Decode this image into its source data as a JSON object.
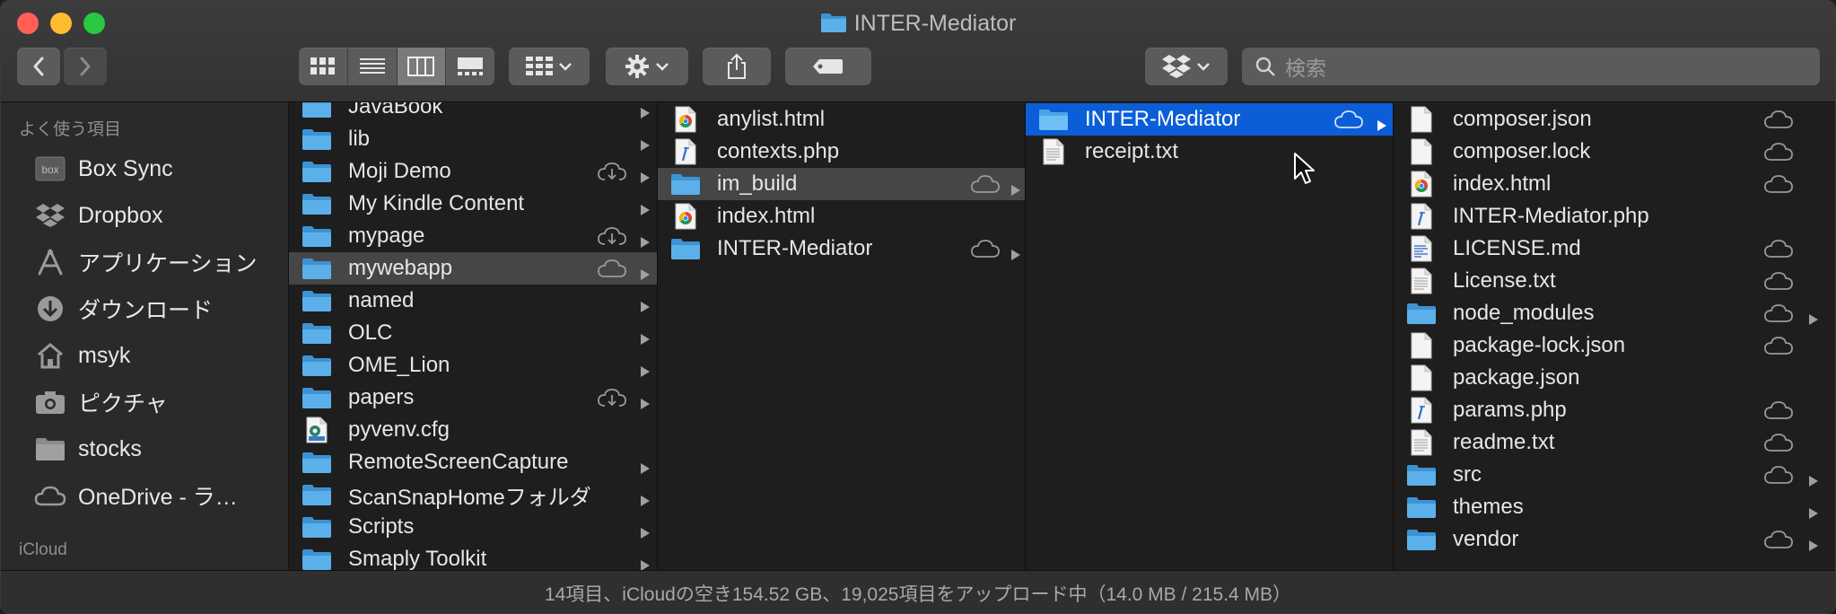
{
  "window": {
    "title": "INTER-Mediator"
  },
  "search": {
    "placeholder": "検索"
  },
  "sidebar": {
    "favorites_header": "よく使う項目",
    "icloud_header": "iCloud",
    "items": [
      {
        "label": "Box Sync",
        "icon": "box-icon"
      },
      {
        "label": "Dropbox",
        "icon": "dropbox-icon"
      },
      {
        "label": "アプリケーション",
        "icon": "applications-icon"
      },
      {
        "label": "ダウンロード",
        "icon": "downloads-icon"
      },
      {
        "label": "msyk",
        "icon": "home-icon"
      },
      {
        "label": "ピクチャ",
        "icon": "camera-icon"
      },
      {
        "label": "stocks",
        "icon": "folder-icon"
      },
      {
        "label": "OneDrive - ラ…",
        "icon": "cloud-icon"
      }
    ]
  },
  "columns": [
    {
      "items": [
        {
          "name": "JavaBook",
          "type": "folder",
          "arrow": true
        },
        {
          "name": "lib",
          "type": "folder",
          "arrow": true
        },
        {
          "name": "Moji Demo",
          "type": "folder",
          "cloud": "download",
          "arrow": true
        },
        {
          "name": "My Kindle Content",
          "type": "folder",
          "arrow": true
        },
        {
          "name": "mypage",
          "type": "folder",
          "cloud": "download",
          "arrow": true
        },
        {
          "name": "mywebapp",
          "type": "folder",
          "cloud": "cloud",
          "arrow": true,
          "selected": "gray"
        },
        {
          "name": "named",
          "type": "folder",
          "arrow": true
        },
        {
          "name": "OLC",
          "type": "folder",
          "arrow": true
        },
        {
          "name": "OME_Lion",
          "type": "folder",
          "arrow": true
        },
        {
          "name": "papers",
          "type": "folder",
          "cloud": "download",
          "arrow": true
        },
        {
          "name": "pyvenv.cfg",
          "type": "cfg"
        },
        {
          "name": "RemoteScreenCapture",
          "type": "folder",
          "arrow": true
        },
        {
          "name": "ScanSnapHomeフォルダ",
          "type": "folder",
          "arrow": true
        },
        {
          "name": "Scripts",
          "type": "folder",
          "arrow": true
        },
        {
          "name": "Smaply Toolkit",
          "type": "folder",
          "arrow": true
        }
      ]
    },
    {
      "items": [
        {
          "name": "anylist.html",
          "type": "chrome"
        },
        {
          "name": "contexts.php",
          "type": "php"
        },
        {
          "name": "im_build",
          "type": "folder",
          "cloud": "cloud",
          "arrow": true,
          "selected": "gray"
        },
        {
          "name": "index.html",
          "type": "chrome"
        },
        {
          "name": "INTER-Mediator",
          "type": "folder",
          "cloud": "cloud",
          "arrow": true
        }
      ]
    },
    {
      "items": [
        {
          "name": "INTER-Mediator",
          "type": "folder",
          "cloud": "cloud",
          "arrow": true,
          "selected": "blue"
        },
        {
          "name": "receipt.txt",
          "type": "txt"
        }
      ]
    },
    {
      "items": [
        {
          "name": "composer.json",
          "type": "doc",
          "cloud": "cloud"
        },
        {
          "name": "composer.lock",
          "type": "doc",
          "cloud": "cloud"
        },
        {
          "name": "index.html",
          "type": "chrome",
          "cloud": "cloud"
        },
        {
          "name": "INTER-Mediator.php",
          "type": "php"
        },
        {
          "name": "LICENSE.md",
          "type": "md",
          "cloud": "cloud"
        },
        {
          "name": "License.txt",
          "type": "txt",
          "cloud": "cloud"
        },
        {
          "name": "node_modules",
          "type": "folder",
          "cloud": "cloud",
          "arrow": true
        },
        {
          "name": "package-lock.json",
          "type": "doc",
          "cloud": "cloud"
        },
        {
          "name": "package.json",
          "type": "doc"
        },
        {
          "name": "params.php",
          "type": "php",
          "cloud": "cloud"
        },
        {
          "name": "readme.txt",
          "type": "txt",
          "cloud": "cloud"
        },
        {
          "name": "src",
          "type": "folder",
          "cloud": "cloud",
          "arrow": true
        },
        {
          "name": "themes",
          "type": "folder",
          "arrow": true
        },
        {
          "name": "vendor",
          "type": "folder",
          "cloud": "cloud",
          "arrow": true
        }
      ]
    }
  ],
  "status": {
    "text": "14項目、iCloudの空き154.52 GB、19,025項目をアップロード中（14.0 MB / 215.4 MB）"
  },
  "colors": {
    "selection_blue": "#0b5ed7",
    "folder_blue": "#4aa3e0",
    "selection_gray": "#464646"
  }
}
